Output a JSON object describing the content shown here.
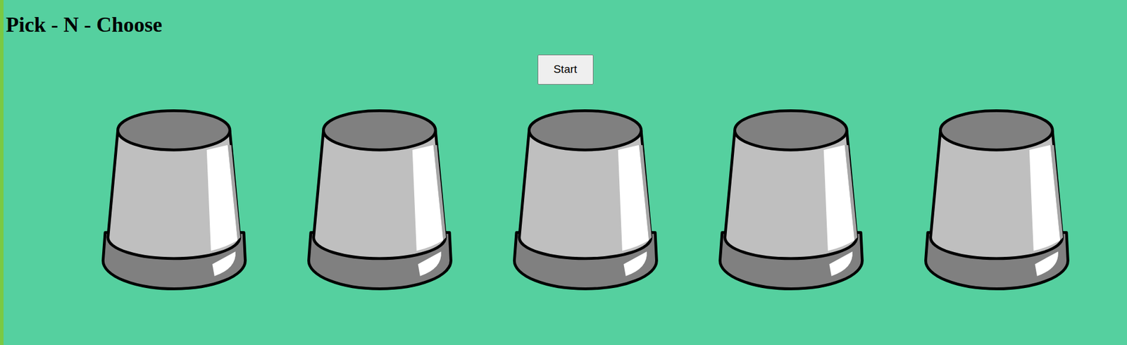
{
  "title": "Pick - N - Choose",
  "start_button": {
    "label": "Start"
  },
  "cups": [
    {
      "lifted": false
    },
    {
      "lifted": false
    },
    {
      "lifted": false
    },
    {
      "lifted": false
    },
    {
      "lifted": false
    }
  ]
}
